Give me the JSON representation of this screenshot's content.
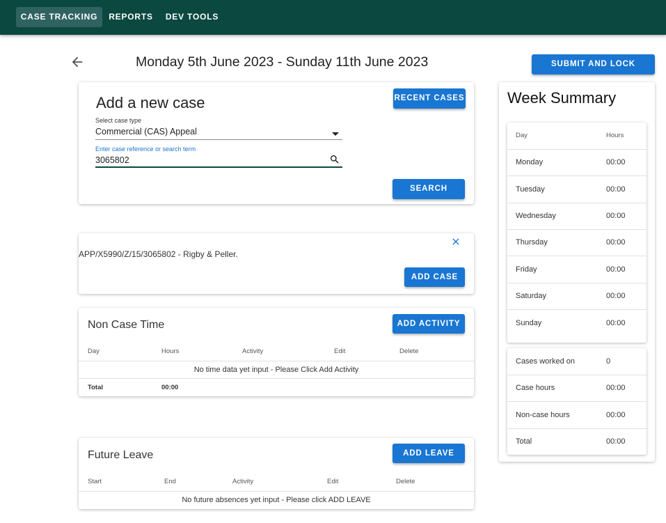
{
  "nav": {
    "tabs": [
      {
        "label": "CASE TRACKING"
      },
      {
        "label": "REPORTS"
      },
      {
        "label": "DEV TOOLS"
      }
    ]
  },
  "header": {
    "week_title": "Monday 5th June 2023 - Sunday 11th June 2023",
    "submit_label": "SUBMIT AND LOCK"
  },
  "add_case": {
    "title": "Add a new case",
    "recent_label": "RECENT CASES",
    "case_type_label": "Select case type",
    "case_type_value": "Commercial (CAS) Appeal",
    "search_label": "Enter case reference or search term",
    "search_value": "3065802",
    "search_button": "SEARCH"
  },
  "result": {
    "text": "APP/X5990/Z/15/3065802 - Rigby & Peller.",
    "add_label": "ADD CASE"
  },
  "non_case": {
    "title": "Non Case Time",
    "add_label": "ADD ACTIVITY",
    "headers": [
      "Day",
      "Hours",
      "Activity",
      "Edit",
      "Delete"
    ],
    "empty_text": "No time data yet input - Please Click Add Activity",
    "total_label": "Total",
    "total_value": "00:00"
  },
  "future_leave": {
    "title": "Future Leave",
    "add_label": "ADD LEAVE",
    "headers": [
      "Start",
      "End",
      "Activity",
      "Edit",
      "Delete"
    ],
    "empty_text": "No future absences yet input - Please click ADD LEAVE"
  },
  "summary": {
    "title": "Week Summary",
    "day_header": "Day",
    "hours_header": "Hours",
    "days": [
      {
        "day": "Monday",
        "hours": "00:00"
      },
      {
        "day": "Tuesday",
        "hours": "00:00"
      },
      {
        "day": "Wednesday",
        "hours": "00:00"
      },
      {
        "day": "Thursday",
        "hours": "00:00"
      },
      {
        "day": "Friday",
        "hours": "00:00"
      },
      {
        "day": "Saturday",
        "hours": "00:00"
      },
      {
        "day": "Sunday",
        "hours": "00:00"
      }
    ],
    "totals": [
      {
        "label": "Cases worked on",
        "value": "0"
      },
      {
        "label": "Case hours",
        "value": "00:00"
      },
      {
        "label": "Non-case hours",
        "value": "00:00"
      },
      {
        "label": "Total",
        "value": "00:00"
      }
    ]
  },
  "colors": {
    "topbar": "#0b4840",
    "active_tab": "#2f6361",
    "primary": "#1976d2"
  }
}
